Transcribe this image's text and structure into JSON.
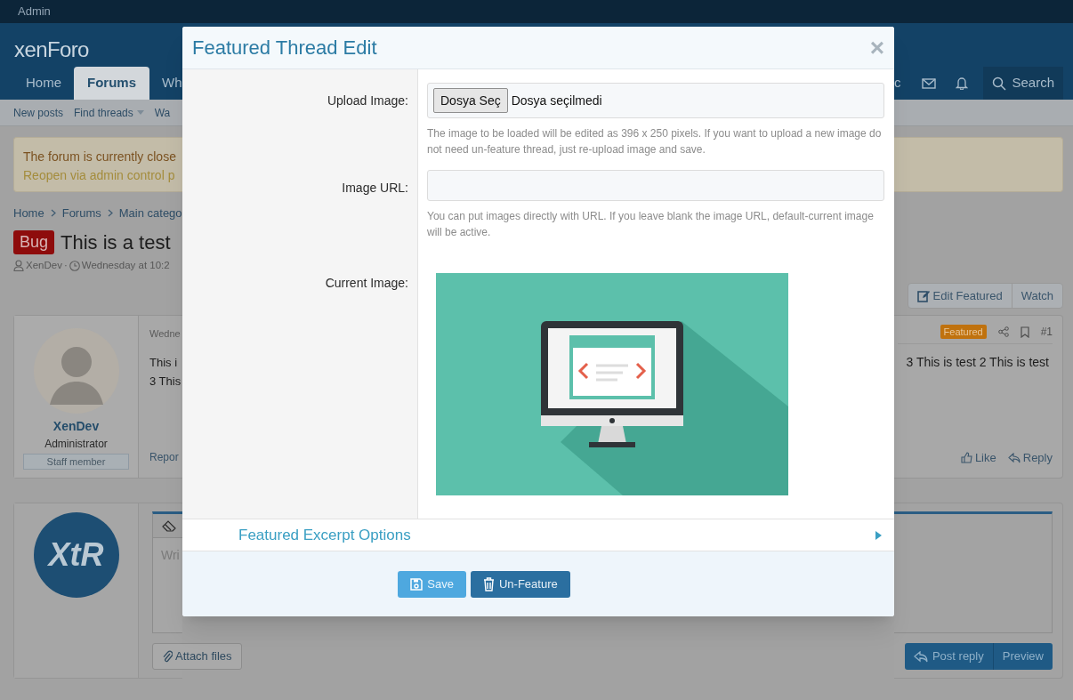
{
  "top_bar": {
    "label": "Admin"
  },
  "header": {
    "logo": "xenForo",
    "nav_tabs": [
      {
        "label": "Home",
        "selected": false
      },
      {
        "label": "Forums",
        "selected": true
      },
      {
        "label": "Wh",
        "selected": false
      }
    ],
    "nav_fragment": "c",
    "search_label": "Search"
  },
  "sub_nav": [
    {
      "label": "New posts",
      "has_menu": false
    },
    {
      "label": "Find threads",
      "has_menu": true
    },
    {
      "label": "Wa",
      "has_menu": false
    }
  ],
  "notice": {
    "lines": [
      "The forum is currently close",
      "Reopen via admin control p"
    ]
  },
  "breadcrumb": [
    "Home",
    "Forums",
    "Main catego"
  ],
  "thread": {
    "prefix": "Bug",
    "title": "This is a test",
    "author": "XenDev",
    "separator": "·",
    "date": "Wednesday at 10:2"
  },
  "thread_buttons": [
    {
      "label": "Edit Featured",
      "kind": "edit"
    },
    {
      "label": "Watch",
      "kind": "plain"
    }
  ],
  "post": {
    "author": "XenDev",
    "role": "Administrator",
    "banner": "Staff member",
    "date": "Wedne",
    "body_left": [
      "This i",
      "3 This"
    ],
    "body_right": "3 This is test 2 This is test",
    "badge": "Featured",
    "number": "#1",
    "report": "Repor",
    "actions": [
      {
        "label": "Like",
        "kind": "like"
      },
      {
        "label": "Reply",
        "kind": "reply"
      }
    ]
  },
  "editor": {
    "avatar_text": "XtR",
    "placeholder": "Wri",
    "attach_label": "Attach files",
    "buttons": [
      {
        "label": "Post reply",
        "kind": "reply"
      },
      {
        "label": "Preview",
        "kind": "preview"
      }
    ]
  },
  "modal": {
    "title": "Featured Thread Edit",
    "close": "×",
    "fields": [
      {
        "kind": "file",
        "label": "Upload Image:",
        "button": "Dosya Seç",
        "value": "Dosya seçilmedi",
        "hint": "The image to be loaded will be edited as 396 x 250 pixels. If you want to upload a new image do not need un-feature thread, just re-upload image and save."
      },
      {
        "kind": "text",
        "label": "Image URL:",
        "hint": "You can put images directly with URL. If you leave blank the image URL, default-current image will be active."
      },
      {
        "kind": "image",
        "label": "Current Image:"
      }
    ],
    "excerpt_toggle": {
      "label": "Featured Excerpt Options",
      "expanded": false
    },
    "buttons": [
      {
        "label": "Save",
        "kind": "primary"
      },
      {
        "label": "Un-Feature",
        "kind": "secondary"
      }
    ]
  }
}
